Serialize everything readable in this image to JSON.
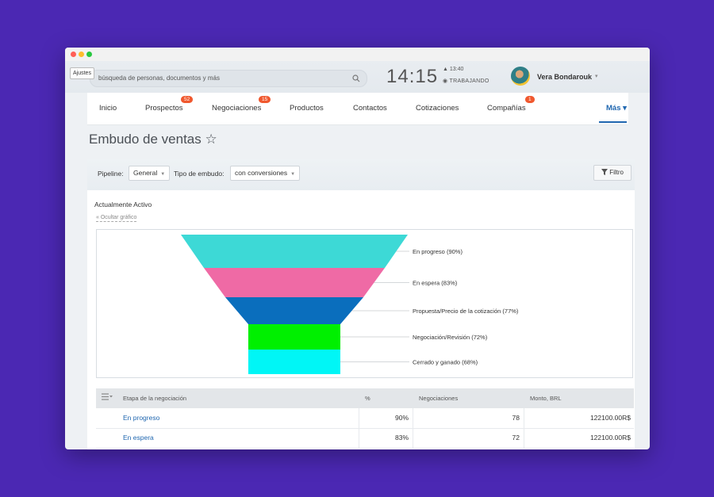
{
  "topbar": {
    "settings_label": "Ajustes",
    "search_placeholder": "búsqueda de personas, documentos y más",
    "clock": "14:15",
    "status_time": "▲ 13:40",
    "status_work": "◉ TRABAJANDO",
    "user_name": "Vera Bondarouk"
  },
  "nav": {
    "items": [
      {
        "label": "Inicio"
      },
      {
        "label": "Prospectos",
        "badge": "52"
      },
      {
        "label": "Negociaciones",
        "badge": "15"
      },
      {
        "label": "Productos"
      },
      {
        "label": "Contactos"
      },
      {
        "label": "Cotizaciones"
      },
      {
        "label": "Compañías",
        "badge": "1"
      },
      {
        "label": "Más ▾"
      }
    ]
  },
  "page": {
    "title": "Embudo de ventas ☆"
  },
  "toolbar": {
    "pipeline_label": "Pipeline:",
    "pipeline_value": "General",
    "funnel_type_label": "Tipo de embudo:",
    "funnel_type_value": "con conversiones",
    "filter_label": "Filtro"
  },
  "section": {
    "title": "Actualmente Activo",
    "hide_chart": "« Ocultar gráfico"
  },
  "chart_data": {
    "type": "funnel",
    "stages": [
      {
        "label": "En progreso (90%)",
        "value": 90,
        "color": "#3dd9d6"
      },
      {
        "label": "En espera (83%)",
        "value": 83,
        "color": "#ef6aa5"
      },
      {
        "label": "Propuesta/Precio de la cotización (77%)",
        "value": 77,
        "color": "#0a6ebd"
      },
      {
        "label": "Negociación/Revisión (72%)",
        "value": 72,
        "color": "#00f000"
      },
      {
        "label": "Cerrado y ganado (68%)",
        "value": 68,
        "color": "#00f6f6"
      }
    ]
  },
  "table": {
    "headers": [
      "Etapa de la negociación",
      "%",
      "Negociaciones",
      "Monto, BRL"
    ],
    "rows": [
      {
        "stage": "En progreso",
        "percent": "90%",
        "deals": "78",
        "amount": "122100.00R$"
      },
      {
        "stage": "En espera",
        "percent": "83%",
        "deals": "72",
        "amount": "122100.00R$"
      }
    ]
  }
}
